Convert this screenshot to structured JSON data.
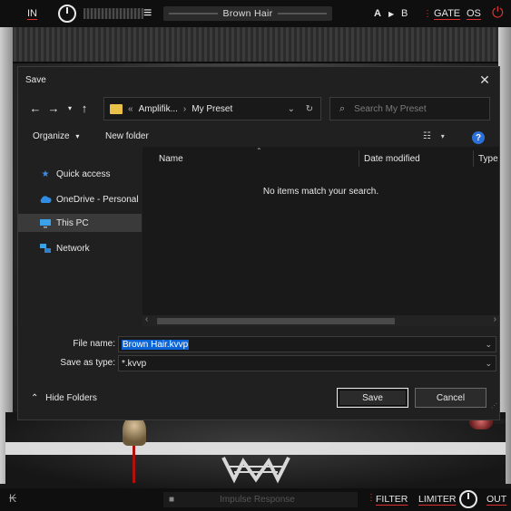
{
  "topbar": {
    "in_label": "IN",
    "preset_name": "Brown Hair",
    "ab_a": "A",
    "ab_arrow": "▶",
    "ab_b": "B",
    "gate_label": "GATE",
    "os_label": "OS"
  },
  "dialog": {
    "title": "Save",
    "address": {
      "prefix": "«",
      "segment1": "Amplifik...",
      "separator": "›",
      "segment2": "My Preset"
    },
    "search_placeholder": "Search My Preset",
    "organize_label": "Organize",
    "new_folder_label": "New folder",
    "nav_items": [
      {
        "label": "Quick access",
        "icon": "star-icon"
      },
      {
        "label": "OneDrive - Personal",
        "icon": "cloud-icon"
      },
      {
        "label": "This PC",
        "icon": "monitor-icon",
        "selected": true
      },
      {
        "label": "Network",
        "icon": "network-icon"
      }
    ],
    "columns": {
      "name": "Name",
      "date": "Date modified",
      "type": "Type"
    },
    "empty_message": "No items match your search.",
    "file_name_label": "File name:",
    "file_name_value": "Brown Hair.kvvp",
    "save_type_label": "Save as type:",
    "save_type_value": "*.kvvp",
    "hide_folders_label": "Hide Folders",
    "save_button": "Save",
    "cancel_button": "Cancel"
  },
  "bottombar": {
    "ir_label": "Impulse Response",
    "filter_label": "FILTER",
    "limiter_label": "LIMITER",
    "out_label": "OUT"
  },
  "colors": {
    "accent_red": "#e03030",
    "selection_blue": "#0a64d8",
    "folder_yellow": "#e8c04a"
  }
}
